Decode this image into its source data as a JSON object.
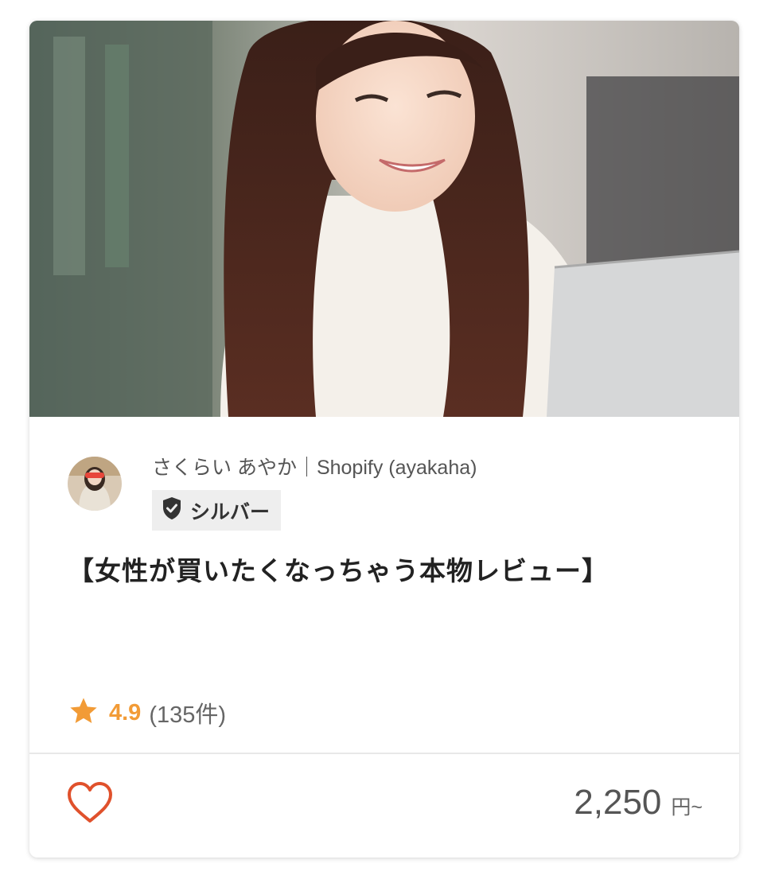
{
  "service_card": {
    "seller": {
      "display_name": "さくらい あやか｜Shopify (ayakaha)",
      "avatar_icon": "user-avatar",
      "rank": {
        "icon": "shield-check-icon",
        "label": "シルバー"
      }
    },
    "title": "【女性が買いたくなっちゃう本物レビュー】",
    "rating": {
      "icon": "star-icon",
      "value": "4.9",
      "count": "(135件)"
    },
    "favorite_icon": "heart-outline-icon",
    "price": {
      "amount": "2,250",
      "unit": "円~"
    },
    "colors": {
      "accent_star": "#f29b36",
      "heart": "#e0512c",
      "badge_bg": "#eeeeee"
    }
  }
}
